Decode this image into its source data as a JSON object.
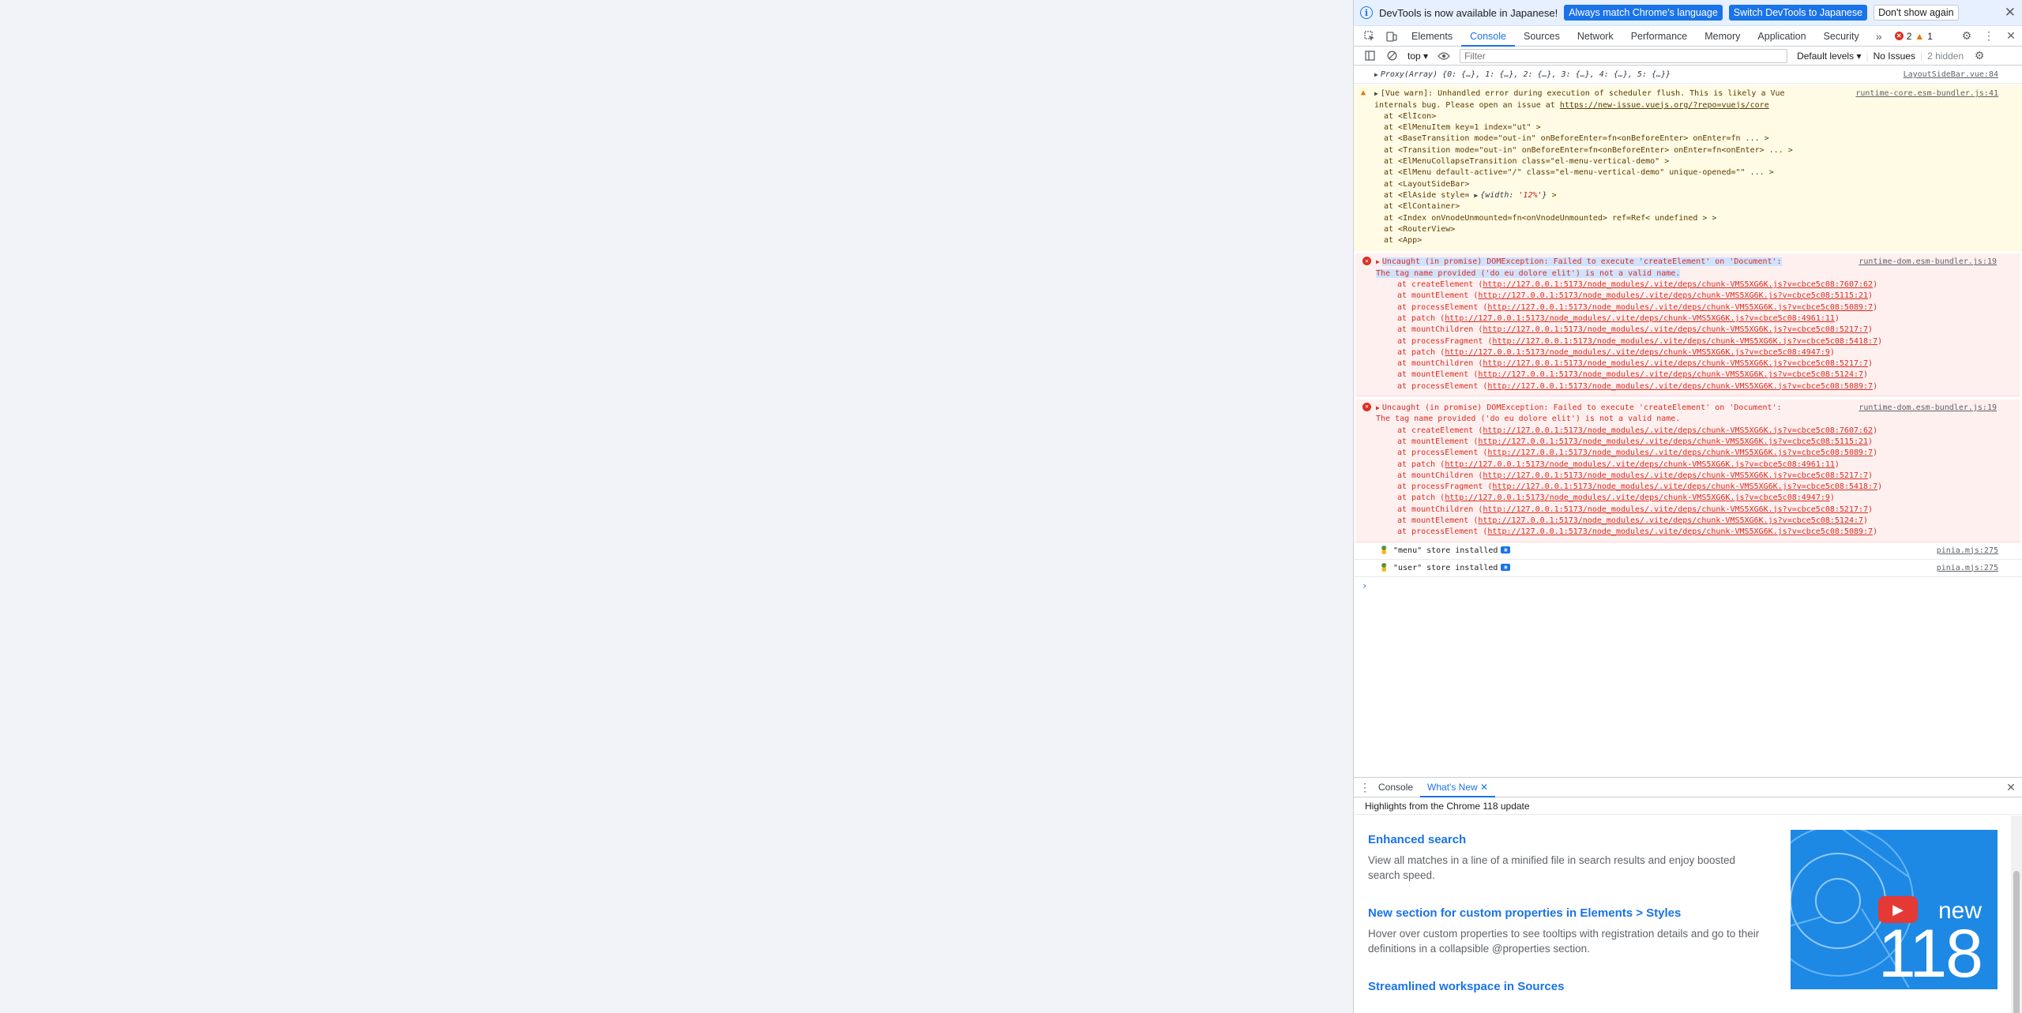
{
  "infobar": {
    "text": "DevTools is now available in Japanese!",
    "btn_match": "Always match Chrome's language",
    "btn_switch": "Switch DevTools to Japanese",
    "btn_dont": "Don't show again"
  },
  "tabs": [
    "Elements",
    "Console",
    "Sources",
    "Network",
    "Performance",
    "Memory",
    "Application",
    "Security"
  ],
  "badges": {
    "errors": "2",
    "warnings": "1"
  },
  "toolbar": {
    "context": "top",
    "filter_placeholder": "Filter",
    "levels": "Default levels",
    "issues": "No Issues",
    "hidden": "2 hidden"
  },
  "console": {
    "proxy": {
      "text": "Proxy(Array) {0: {…}, 1: {…}, 2: {…}, 3: {…}, 4: {…}, 5: {…}}",
      "src": "LayoutSideBar.vue:84"
    },
    "warn": {
      "line1": "[Vue warn]: Unhandled error during execution of scheduler flush. This is likely a Vue",
      "line2_pre": "internals bug. Please open an issue at ",
      "line2_link": "https://new-issue.vuejs.org/?repo=vuejs/core",
      "src": "runtime-core.esm-bundler.js:41",
      "stack": [
        "at <ElIcon>",
        "at <ElMenuItem key=1 index=\"ut\" >",
        "at <BaseTransition mode=\"out-in\" onBeforeEnter=fn<onBeforeEnter> onEnter=fn  ... >",
        "at <Transition mode=\"out-in\" onBeforeEnter=fn<onBeforeEnter> onEnter=fn<onEnter>  ... >",
        "at <ElMenuCollapseTransition class=\"el-menu-vertical-demo\" >",
        "at <ElMenu default-active=\"/\" class=\"el-menu-vertical-demo\" unique-opened=\"\"  ... >",
        "at <LayoutSideBar>",
        "at <ElAside style=",
        "at <ElContainer>",
        "at <Index onVnodeUnmounted=fn<onVnodeUnmounted> ref=Ref< undefined > >",
        "at <RouterView>",
        "at <App>"
      ],
      "aside_obj_key": "{width: ",
      "aside_obj_val": "'12%'",
      "aside_obj_end": "}",
      "aside_tail": " >"
    },
    "errors": [
      {
        "line1": "Uncaught (in promise) DOMException: Failed to execute 'createElement' on 'Document':",
        "line2": "The tag name provided ('do eu dolore elit') is not a valid name.",
        "src": "runtime-dom.esm-bundler.js:19",
        "stack": [
          {
            "fn": "at createElement (",
            "url": "http://127.0.0.1:5173/node_modules/.vite/deps/chunk-VMS5XG6K.js?v=cbce5c08:7607:62",
            "end": ")"
          },
          {
            "fn": "at mountElement (",
            "url": "http://127.0.0.1:5173/node_modules/.vite/deps/chunk-VMS5XG6K.js?v=cbce5c08:5115:21",
            "end": ")"
          },
          {
            "fn": "at processElement (",
            "url": "http://127.0.0.1:5173/node_modules/.vite/deps/chunk-VMS5XG6K.js?v=cbce5c08:5089:7",
            "end": ")"
          },
          {
            "fn": "at patch (",
            "url": "http://127.0.0.1:5173/node_modules/.vite/deps/chunk-VMS5XG6K.js?v=cbce5c08:4961:11",
            "end": ")"
          },
          {
            "fn": "at mountChildren (",
            "url": "http://127.0.0.1:5173/node_modules/.vite/deps/chunk-VMS5XG6K.js?v=cbce5c08:5217:7",
            "end": ")"
          },
          {
            "fn": "at processFragment (",
            "url": "http://127.0.0.1:5173/node_modules/.vite/deps/chunk-VMS5XG6K.js?v=cbce5c08:5418:7",
            "end": ")"
          },
          {
            "fn": "at patch (",
            "url": "http://127.0.0.1:5173/node_modules/.vite/deps/chunk-VMS5XG6K.js?v=cbce5c08:4947:9",
            "end": ")"
          },
          {
            "fn": "at mountChildren (",
            "url": "http://127.0.0.1:5173/node_modules/.vite/deps/chunk-VMS5XG6K.js?v=cbce5c08:5217:7",
            "end": ")"
          },
          {
            "fn": "at mountElement (",
            "url": "http://127.0.0.1:5173/node_modules/.vite/deps/chunk-VMS5XG6K.js?v=cbce5c08:5124:7",
            "end": ")"
          },
          {
            "fn": "at processElement (",
            "url": "http://127.0.0.1:5173/node_modules/.vite/deps/chunk-VMS5XG6K.js?v=cbce5c08:5089:7",
            "end": ")"
          }
        ]
      },
      {
        "line1": "Uncaught (in promise) DOMException: Failed to execute 'createElement' on 'Document':",
        "line2": "The tag name provided ('do eu dolore elit') is not a valid name.",
        "src": "runtime-dom.esm-bundler.js:19",
        "stack": [
          {
            "fn": "at createElement (",
            "url": "http://127.0.0.1:5173/node_modules/.vite/deps/chunk-VMS5XG6K.js?v=cbce5c08:7607:62",
            "end": ")"
          },
          {
            "fn": "at mountElement (",
            "url": "http://127.0.0.1:5173/node_modules/.vite/deps/chunk-VMS5XG6K.js?v=cbce5c08:5115:21",
            "end": ")"
          },
          {
            "fn": "at processElement (",
            "url": "http://127.0.0.1:5173/node_modules/.vite/deps/chunk-VMS5XG6K.js?v=cbce5c08:5089:7",
            "end": ")"
          },
          {
            "fn": "at patch (",
            "url": "http://127.0.0.1:5173/node_modules/.vite/deps/chunk-VMS5XG6K.js?v=cbce5c08:4961:11",
            "end": ")"
          },
          {
            "fn": "at mountChildren (",
            "url": "http://127.0.0.1:5173/node_modules/.vite/deps/chunk-VMS5XG6K.js?v=cbce5c08:5217:7",
            "end": ")"
          },
          {
            "fn": "at processFragment (",
            "url": "http://127.0.0.1:5173/node_modules/.vite/deps/chunk-VMS5XG6K.js?v=cbce5c08:5418:7",
            "end": ")"
          },
          {
            "fn": "at patch (",
            "url": "http://127.0.0.1:5173/node_modules/.vite/deps/chunk-VMS5XG6K.js?v=cbce5c08:4947:9",
            "end": ")"
          },
          {
            "fn": "at mountChildren (",
            "url": "http://127.0.0.1:5173/node_modules/.vite/deps/chunk-VMS5XG6K.js?v=cbce5c08:5217:7",
            "end": ")"
          },
          {
            "fn": "at mountElement (",
            "url": "http://127.0.0.1:5173/node_modules/.vite/deps/chunk-VMS5XG6K.js?v=cbce5c08:5124:7",
            "end": ")"
          },
          {
            "fn": "at processElement (",
            "url": "http://127.0.0.1:5173/node_modules/.vite/deps/chunk-VMS5XG6K.js?v=cbce5c08:5089:7",
            "end": ")"
          }
        ]
      }
    ],
    "logs": [
      {
        "text": "\"menu\" store installed",
        "src": "pinia.mjs:275"
      },
      {
        "text": "\"user\" store installed",
        "src": "pinia.mjs:275"
      }
    ],
    "prompt": "›"
  },
  "drawer": {
    "tabs": [
      "Console",
      "What's New"
    ],
    "highlights": "Highlights from the Chrome 118 update",
    "features": [
      {
        "title": "Enhanced search",
        "desc": "View all matches in a line of a minified file in search results and enjoy boosted search speed."
      },
      {
        "title": "New section for custom properties in Elements > Styles",
        "desc": "Hover over custom properties to see tooltips with registration details and go to their definitions in a collapsible @properties section."
      },
      {
        "title": "Streamlined workspace in Sources",
        "desc": ""
      }
    ],
    "video": {
      "word": "new",
      "number": "118"
    }
  },
  "colors": {
    "accent": "#1a73e8",
    "error": "#d93025",
    "warning": "#e37400"
  }
}
